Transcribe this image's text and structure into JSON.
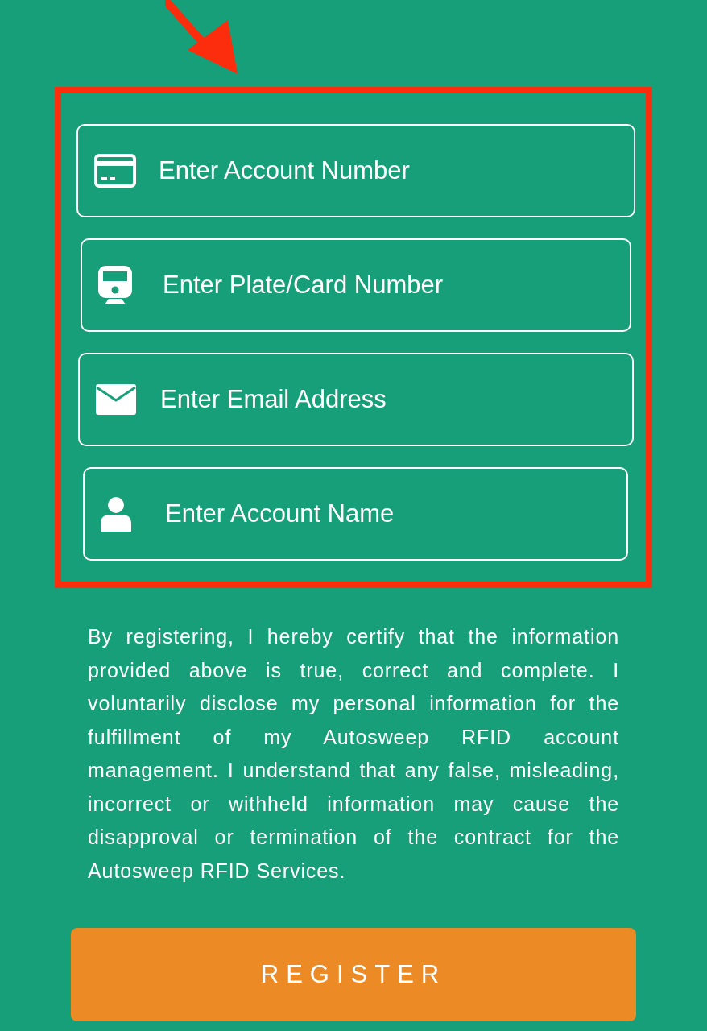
{
  "form_fields": [
    {
      "kind": "card",
      "placeholder": "Enter Account Number"
    },
    {
      "kind": "tag",
      "placeholder": "Enter Plate/Card Number"
    },
    {
      "kind": "email",
      "placeholder": "Enter Email Address"
    },
    {
      "kind": "person",
      "placeholder": "Enter Account Name"
    }
  ],
  "disclaimer": "By registering, I hereby certify that the information provided above is true, correct and complete. I voluntarily disclose my personal information for the fulfillment of my Autosweep RFID account management. I understand that any false, misleading, incorrect or withheld information may cause the disapproval or termination of the contract for the Autosweep RFID Services.",
  "register_button": "REGISTER"
}
